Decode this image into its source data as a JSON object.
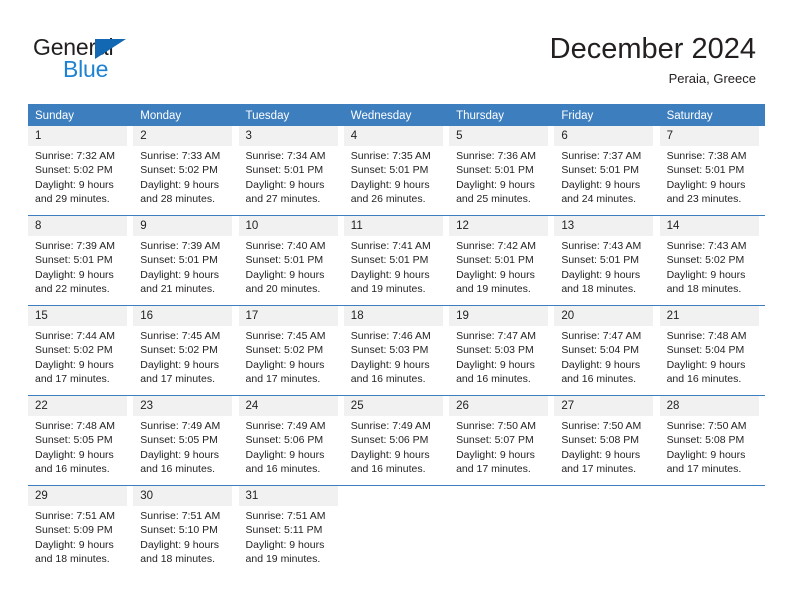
{
  "brand": {
    "name_part1": "General",
    "name_part2": "Blue",
    "triangle_color": "#1268b3",
    "blue_text_color": "#1e82d2"
  },
  "header": {
    "title": "December 2024",
    "location": "Peraia, Greece"
  },
  "theme": {
    "header_blue": "#3d7ebf",
    "day_number_bg": "#f1f1f1",
    "text_color": "#231f20"
  },
  "weekdays": [
    "Sunday",
    "Monday",
    "Tuesday",
    "Wednesday",
    "Thursday",
    "Friday",
    "Saturday"
  ],
  "weeks": [
    [
      {
        "day": "1",
        "sunrise": "Sunrise: 7:32 AM",
        "sunset": "Sunset: 5:02 PM",
        "daylight_line1": "Daylight: 9 hours",
        "daylight_line2": "and 29 minutes."
      },
      {
        "day": "2",
        "sunrise": "Sunrise: 7:33 AM",
        "sunset": "Sunset: 5:02 PM",
        "daylight_line1": "Daylight: 9 hours",
        "daylight_line2": "and 28 minutes."
      },
      {
        "day": "3",
        "sunrise": "Sunrise: 7:34 AM",
        "sunset": "Sunset: 5:01 PM",
        "daylight_line1": "Daylight: 9 hours",
        "daylight_line2": "and 27 minutes."
      },
      {
        "day": "4",
        "sunrise": "Sunrise: 7:35 AM",
        "sunset": "Sunset: 5:01 PM",
        "daylight_line1": "Daylight: 9 hours",
        "daylight_line2": "and 26 minutes."
      },
      {
        "day": "5",
        "sunrise": "Sunrise: 7:36 AM",
        "sunset": "Sunset: 5:01 PM",
        "daylight_line1": "Daylight: 9 hours",
        "daylight_line2": "and 25 minutes."
      },
      {
        "day": "6",
        "sunrise": "Sunrise: 7:37 AM",
        "sunset": "Sunset: 5:01 PM",
        "daylight_line1": "Daylight: 9 hours",
        "daylight_line2": "and 24 minutes."
      },
      {
        "day": "7",
        "sunrise": "Sunrise: 7:38 AM",
        "sunset": "Sunset: 5:01 PM",
        "daylight_line1": "Daylight: 9 hours",
        "daylight_line2": "and 23 minutes."
      }
    ],
    [
      {
        "day": "8",
        "sunrise": "Sunrise: 7:39 AM",
        "sunset": "Sunset: 5:01 PM",
        "daylight_line1": "Daylight: 9 hours",
        "daylight_line2": "and 22 minutes."
      },
      {
        "day": "9",
        "sunrise": "Sunrise: 7:39 AM",
        "sunset": "Sunset: 5:01 PM",
        "daylight_line1": "Daylight: 9 hours",
        "daylight_line2": "and 21 minutes."
      },
      {
        "day": "10",
        "sunrise": "Sunrise: 7:40 AM",
        "sunset": "Sunset: 5:01 PM",
        "daylight_line1": "Daylight: 9 hours",
        "daylight_line2": "and 20 minutes."
      },
      {
        "day": "11",
        "sunrise": "Sunrise: 7:41 AM",
        "sunset": "Sunset: 5:01 PM",
        "daylight_line1": "Daylight: 9 hours",
        "daylight_line2": "and 19 minutes."
      },
      {
        "day": "12",
        "sunrise": "Sunrise: 7:42 AM",
        "sunset": "Sunset: 5:01 PM",
        "daylight_line1": "Daylight: 9 hours",
        "daylight_line2": "and 19 minutes."
      },
      {
        "day": "13",
        "sunrise": "Sunrise: 7:43 AM",
        "sunset": "Sunset: 5:01 PM",
        "daylight_line1": "Daylight: 9 hours",
        "daylight_line2": "and 18 minutes."
      },
      {
        "day": "14",
        "sunrise": "Sunrise: 7:43 AM",
        "sunset": "Sunset: 5:02 PM",
        "daylight_line1": "Daylight: 9 hours",
        "daylight_line2": "and 18 minutes."
      }
    ],
    [
      {
        "day": "15",
        "sunrise": "Sunrise: 7:44 AM",
        "sunset": "Sunset: 5:02 PM",
        "daylight_line1": "Daylight: 9 hours",
        "daylight_line2": "and 17 minutes."
      },
      {
        "day": "16",
        "sunrise": "Sunrise: 7:45 AM",
        "sunset": "Sunset: 5:02 PM",
        "daylight_line1": "Daylight: 9 hours",
        "daylight_line2": "and 17 minutes."
      },
      {
        "day": "17",
        "sunrise": "Sunrise: 7:45 AM",
        "sunset": "Sunset: 5:02 PM",
        "daylight_line1": "Daylight: 9 hours",
        "daylight_line2": "and 17 minutes."
      },
      {
        "day": "18",
        "sunrise": "Sunrise: 7:46 AM",
        "sunset": "Sunset: 5:03 PM",
        "daylight_line1": "Daylight: 9 hours",
        "daylight_line2": "and 16 minutes."
      },
      {
        "day": "19",
        "sunrise": "Sunrise: 7:47 AM",
        "sunset": "Sunset: 5:03 PM",
        "daylight_line1": "Daylight: 9 hours",
        "daylight_line2": "and 16 minutes."
      },
      {
        "day": "20",
        "sunrise": "Sunrise: 7:47 AM",
        "sunset": "Sunset: 5:04 PM",
        "daylight_line1": "Daylight: 9 hours",
        "daylight_line2": "and 16 minutes."
      },
      {
        "day": "21",
        "sunrise": "Sunrise: 7:48 AM",
        "sunset": "Sunset: 5:04 PM",
        "daylight_line1": "Daylight: 9 hours",
        "daylight_line2": "and 16 minutes."
      }
    ],
    [
      {
        "day": "22",
        "sunrise": "Sunrise: 7:48 AM",
        "sunset": "Sunset: 5:05 PM",
        "daylight_line1": "Daylight: 9 hours",
        "daylight_line2": "and 16 minutes."
      },
      {
        "day": "23",
        "sunrise": "Sunrise: 7:49 AM",
        "sunset": "Sunset: 5:05 PM",
        "daylight_line1": "Daylight: 9 hours",
        "daylight_line2": "and 16 minutes."
      },
      {
        "day": "24",
        "sunrise": "Sunrise: 7:49 AM",
        "sunset": "Sunset: 5:06 PM",
        "daylight_line1": "Daylight: 9 hours",
        "daylight_line2": "and 16 minutes."
      },
      {
        "day": "25",
        "sunrise": "Sunrise: 7:49 AM",
        "sunset": "Sunset: 5:06 PM",
        "daylight_line1": "Daylight: 9 hours",
        "daylight_line2": "and 16 minutes."
      },
      {
        "day": "26",
        "sunrise": "Sunrise: 7:50 AM",
        "sunset": "Sunset: 5:07 PM",
        "daylight_line1": "Daylight: 9 hours",
        "daylight_line2": "and 17 minutes."
      },
      {
        "day": "27",
        "sunrise": "Sunrise: 7:50 AM",
        "sunset": "Sunset: 5:08 PM",
        "daylight_line1": "Daylight: 9 hours",
        "daylight_line2": "and 17 minutes."
      },
      {
        "day": "28",
        "sunrise": "Sunrise: 7:50 AM",
        "sunset": "Sunset: 5:08 PM",
        "daylight_line1": "Daylight: 9 hours",
        "daylight_line2": "and 17 minutes."
      }
    ],
    [
      {
        "day": "29",
        "sunrise": "Sunrise: 7:51 AM",
        "sunset": "Sunset: 5:09 PM",
        "daylight_line1": "Daylight: 9 hours",
        "daylight_line2": "and 18 minutes."
      },
      {
        "day": "30",
        "sunrise": "Sunrise: 7:51 AM",
        "sunset": "Sunset: 5:10 PM",
        "daylight_line1": "Daylight: 9 hours",
        "daylight_line2": "and 18 minutes."
      },
      {
        "day": "31",
        "sunrise": "Sunrise: 7:51 AM",
        "sunset": "Sunset: 5:11 PM",
        "daylight_line1": "Daylight: 9 hours",
        "daylight_line2": "and 19 minutes."
      },
      {
        "day": "",
        "sunrise": "",
        "sunset": "",
        "daylight_line1": "",
        "daylight_line2": ""
      },
      {
        "day": "",
        "sunrise": "",
        "sunset": "",
        "daylight_line1": "",
        "daylight_line2": ""
      },
      {
        "day": "",
        "sunrise": "",
        "sunset": "",
        "daylight_line1": "",
        "daylight_line2": ""
      },
      {
        "day": "",
        "sunrise": "",
        "sunset": "",
        "daylight_line1": "",
        "daylight_line2": ""
      }
    ]
  ]
}
